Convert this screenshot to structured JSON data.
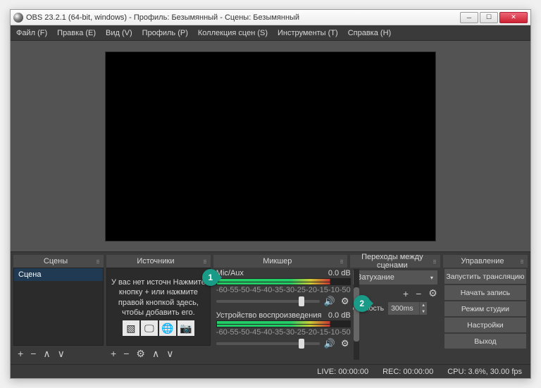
{
  "title": "OBS 23.2.1 (64-bit, windows) - Профиль: Безымянный - Сцены: Безымянный",
  "menu": {
    "file": "Файл (F)",
    "edit": "Правка (E)",
    "view": "Вид (V)",
    "profile": "Профиль (P)",
    "scenes": "Коллекция сцен (S)",
    "tools": "Инструменты (T)",
    "help": "Справка (H)"
  },
  "docks": {
    "scenes": {
      "title": "Сцены",
      "item": "Сцена"
    },
    "sources": {
      "title": "Источники",
      "hint": "У вас нет источн\nНажмите кнопку +\nили нажмите правой кнопкой\nздесь, чтобы добавить его."
    },
    "mixer": {
      "title": "Микшер",
      "ch1": {
        "name": "Mic/Aux",
        "db": "0.0 dB"
      },
      "ch2": {
        "name": "Устройство воспроизведения",
        "db": "0.0 dB"
      },
      "scale": [
        "-60",
        "-55",
        "-50",
        "-45",
        "-40",
        "-35",
        "-30",
        "-25",
        "-20",
        "-15",
        "-10",
        "-5",
        "0"
      ]
    },
    "transitions": {
      "title": "Переходы между сценами",
      "select": "Затухание",
      "duration_label": "ельность",
      "duration_value": "300ms"
    },
    "controls": {
      "title": "Управление",
      "b1": "Запустить трансляцию",
      "b2": "Начать запись",
      "b3": "Режим студии",
      "b4": "Настройки",
      "b5": "Выход"
    }
  },
  "status": {
    "live": "LIVE: 00:00:00",
    "rec": "REC: 00:00:00",
    "cpu": "CPU: 3.6%, 30.00 fps"
  },
  "annotations": {
    "a1": "1",
    "a2": "2"
  }
}
